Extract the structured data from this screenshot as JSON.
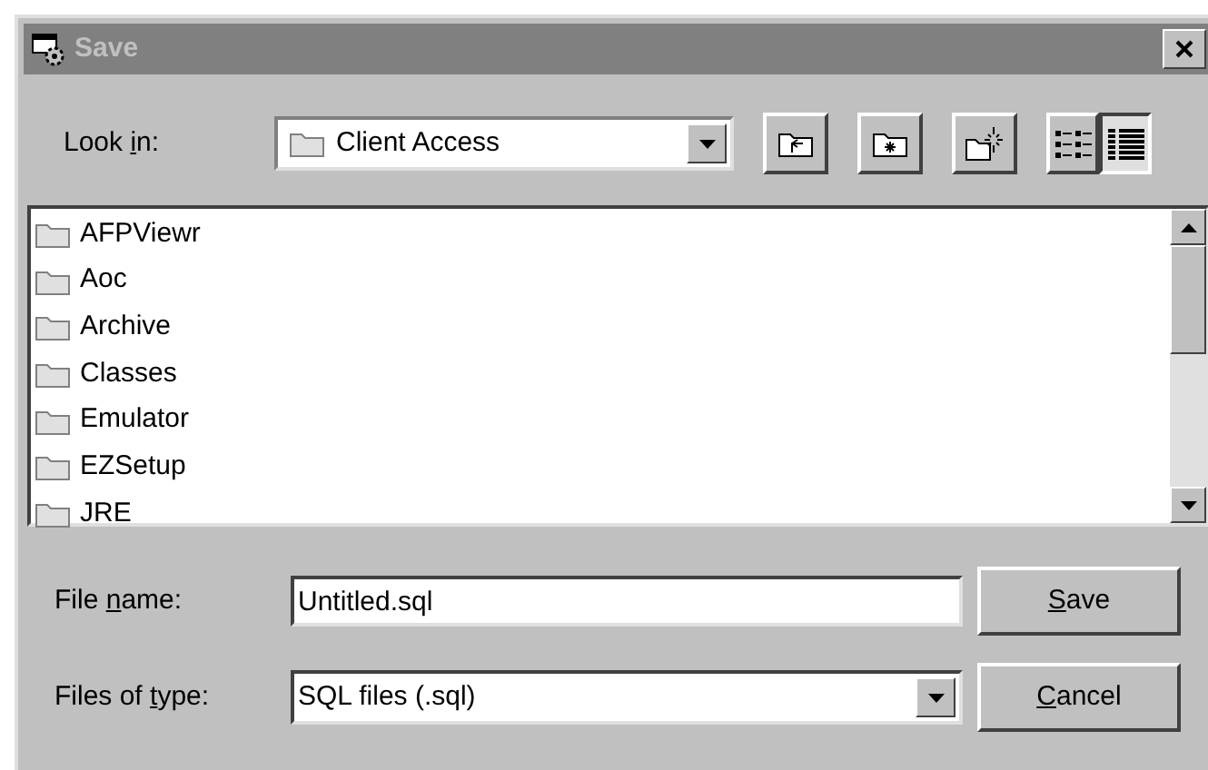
{
  "window": {
    "title": "Save"
  },
  "look_in": {
    "label": {
      "before": "Look ",
      "key": "i",
      "after": "n:"
    },
    "value": "Client Access"
  },
  "view_buttons": [
    {
      "kind": "list",
      "selected": false
    },
    {
      "kind": "details",
      "selected": true
    }
  ],
  "files": [
    {
      "name": "AFPViewr"
    },
    {
      "name": "Aoc"
    },
    {
      "name": "Archive"
    },
    {
      "name": "Classes"
    },
    {
      "name": "Emulator"
    },
    {
      "name": "EZSetup"
    },
    {
      "name": "JRE"
    }
  ],
  "file_name": {
    "label": {
      "before": "File ",
      "key": "n",
      "after": "ame:"
    },
    "value": "Untitled.sql"
  },
  "file_type": {
    "label": {
      "before": "Files of ",
      "key": "t",
      "after": "ype:"
    },
    "value": "SQL files (.sql)"
  },
  "buttons": [
    {
      "key": "S",
      "after": "ave"
    },
    {
      "key": "C",
      "after": "ancel"
    }
  ]
}
